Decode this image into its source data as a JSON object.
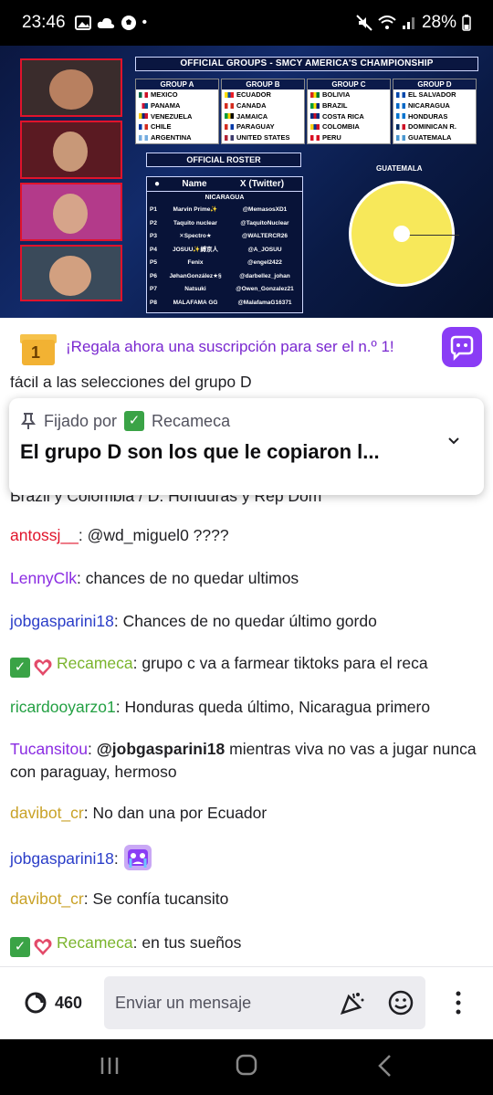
{
  "status_bar": {
    "time": "23:46",
    "dot": "•",
    "battery": "28%"
  },
  "stream": {
    "title": "OFFICIAL GROUPS - SMCY AMERICA'S CHAMPIONSHIP",
    "groups": [
      {
        "name": "GROUP A",
        "teams": [
          {
            "name": "MEXICO",
            "flag": [
              "#006847",
              "#ffffff",
              "#ce1126"
            ]
          },
          {
            "name": "PANAMA",
            "flag": [
              "#ffffff",
              "#d21034",
              "#005293"
            ]
          },
          {
            "name": "VENEZUELA",
            "flag": [
              "#ffcc00",
              "#00247d",
              "#cf142b"
            ]
          },
          {
            "name": "CHILE",
            "flag": [
              "#0039a6",
              "#ffffff",
              "#d52b1e"
            ]
          },
          {
            "name": "ARGENTINA",
            "flag": [
              "#74acdf",
              "#ffffff",
              "#74acdf"
            ]
          }
        ]
      },
      {
        "name": "GROUP B",
        "teams": [
          {
            "name": "ECUADOR",
            "flag": [
              "#ffdd00",
              "#034ea2",
              "#ed1c24"
            ]
          },
          {
            "name": "CANADA",
            "flag": [
              "#d52b1e",
              "#ffffff",
              "#d52b1e"
            ]
          },
          {
            "name": "JAMAICA",
            "flag": [
              "#009b3a",
              "#fed100",
              "#000000"
            ]
          },
          {
            "name": "PARAGUAY",
            "flag": [
              "#d52b1e",
              "#ffffff",
              "#0038a8"
            ]
          },
          {
            "name": "UNITED STATES",
            "flag": [
              "#b22234",
              "#ffffff",
              "#3c3b6e"
            ]
          }
        ]
      },
      {
        "name": "GROUP C",
        "teams": [
          {
            "name": "BOLIVIA",
            "flag": [
              "#d52b1e",
              "#f9e300",
              "#007934"
            ]
          },
          {
            "name": "BRAZIL",
            "flag": [
              "#009c3b",
              "#ffdf00",
              "#002776"
            ]
          },
          {
            "name": "COSTA RICA",
            "flag": [
              "#002b7f",
              "#ce1126",
              "#002b7f"
            ]
          },
          {
            "name": "COLOMBIA",
            "flag": [
              "#fcd116",
              "#003893",
              "#ce1126"
            ]
          },
          {
            "name": "PERU",
            "flag": [
              "#d91023",
              "#ffffff",
              "#d91023"
            ]
          }
        ]
      },
      {
        "name": "GROUP D",
        "teams": [
          {
            "name": "EL SALVADOR",
            "flag": [
              "#0047ab",
              "#ffffff",
              "#0047ab"
            ]
          },
          {
            "name": "NICARAGUA",
            "flag": [
              "#0067c6",
              "#ffffff",
              "#0067c6"
            ]
          },
          {
            "name": "HONDURAS",
            "flag": [
              "#0073cf",
              "#ffffff",
              "#0073cf"
            ]
          },
          {
            "name": "DOMINICAN R.",
            "flag": [
              "#002d62",
              "#ffffff",
              "#ce1126"
            ]
          },
          {
            "name": "GUATEMALA",
            "flag": [
              "#4997d0",
              "#ffffff",
              "#4997d0"
            ]
          }
        ]
      }
    ],
    "roster": {
      "title": "OFFICIAL ROSTER",
      "col_name": "Name",
      "col_x": "X (Twitter)",
      "country": "NICARAGUA",
      "players": [
        {
          "pos": "P1",
          "name": "Marvin Prime✨",
          "handle": "@MemasosXD1"
        },
        {
          "pos": "P2",
          "name": "Taquito nuclear",
          "handle": "@TaquitoNuclear"
        },
        {
          "pos": "P3",
          "name": "✕Spectro★",
          "handle": "@WALTERCR26"
        },
        {
          "pos": "P4",
          "name": "JOSUU✨縛京人",
          "handle": "@A_JOSUU"
        },
        {
          "pos": "P5",
          "name": "Fenix",
          "handle": "@engel2422"
        },
        {
          "pos": "P6",
          "name": "JøhanGonzález★§",
          "handle": "@darbellez_johan"
        },
        {
          "pos": "P7",
          "name": "Natsuki",
          "handle": "@Owen_Gonzalez21"
        },
        {
          "pos": "P8",
          "name": "MALAFAMA GG",
          "handle": "@MalafamaG16371"
        }
      ]
    },
    "wheel_title": "GUATEMALA"
  },
  "promo": {
    "gift_count": "1",
    "text": "¡Regala ahora una suscripción para ser el n.º 1!"
  },
  "chat_top_partial": "fácil a las selecciones del grupo D",
  "chat_partial2": "Brazil y Colombia / D. Honduras y Rep Dom",
  "pinned": {
    "label": "Fijado por",
    "by": "Recameca",
    "text": "El grupo D son los que le copiaron l..."
  },
  "messages": [
    {
      "user": "antossj__",
      "color": "#e0142b",
      "text": ": @wd_miguel0 ????"
    },
    {
      "user": "LennyClk",
      "color": "#8a2be2",
      "text": ": chances de no quedar ultimos"
    },
    {
      "user": "jobgasparini18",
      "color": "#2a3dc8",
      "text": ": Chances de no quedar último gordo"
    },
    {
      "user": "Recameca",
      "color": "#7ab42c",
      "text": ": grupo c va a farmear tiktoks para el reca"
    },
    {
      "user": "ricardooyarzo1",
      "color": "#23a043",
      "text": ": Honduras queda último, Nicaragua primero"
    },
    {
      "user": "Tucansitou",
      "color": "#8a2be2",
      "mention": "@jobgasparini18",
      "text": " mientras viva no vas a jugar nunca con paraguay, hermoso"
    },
    {
      "user": "davibot_cr",
      "color": "#c9a227",
      "text": ": No dan una por Ecuador"
    },
    {
      "user": "jobgasparini18",
      "color": "#2a3dc8",
      "text": ":"
    },
    {
      "user": "davibot_cr",
      "color": "#c9a227",
      "text": ": Se confía tucansito"
    },
    {
      "user": "Recameca",
      "color": "#7ab42c",
      "text": ": en tus sueños"
    }
  ],
  "input": {
    "points": "460",
    "placeholder": "Enviar un mensaje"
  }
}
